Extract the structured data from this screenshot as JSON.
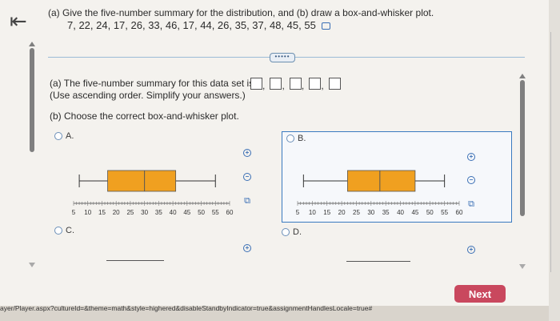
{
  "question": {
    "prompt": "(a) Give the five-number summary for the distribution, and (b) draw a box-and-whisker plot.",
    "data_values": "7, 22, 24, 17, 26, 33, 46, 17, 44, 26, 35, 37, 48, 45, 55"
  },
  "more_label": "•••••",
  "part_a": {
    "line1": "(a) The five-number summary for this data set is",
    "line2": "(Use ascending order. Simplify your answers.)",
    "boxes": 5
  },
  "part_b": {
    "text": "(b) Choose the correct box-and-whisker plot."
  },
  "options": {
    "a": "A.",
    "b": "B.",
    "c": "C.",
    "d": "D."
  },
  "chart_data": [
    {
      "type": "boxplot",
      "option": "A",
      "min": 7,
      "q1": 17,
      "median": 30,
      "q3": 41,
      "max": 55,
      "xlim": [
        5,
        60
      ],
      "ticks": [
        5,
        10,
        15,
        20,
        25,
        30,
        35,
        40,
        45,
        50,
        55,
        60
      ],
      "box_color": "#f0a020"
    },
    {
      "type": "boxplot",
      "option": "B",
      "min": 7,
      "q1": 22,
      "median": 33,
      "q3": 45,
      "max": 55,
      "xlim": [
        5,
        60
      ],
      "ticks": [
        5,
        10,
        15,
        20,
        25,
        30,
        35,
        40,
        45,
        50,
        55,
        60
      ],
      "box_color": "#f0a020"
    }
  ],
  "next_label": "Next",
  "url_text": "ayer/Player.aspx?cultureId=&theme=math&style=highered&disableStandbyIndicator=true&assignmentHandlesLocale=true#",
  "colors": {
    "accent": "#3a6fb5",
    "next_button": "#c9485e",
    "box_fill": "#f0a020"
  }
}
